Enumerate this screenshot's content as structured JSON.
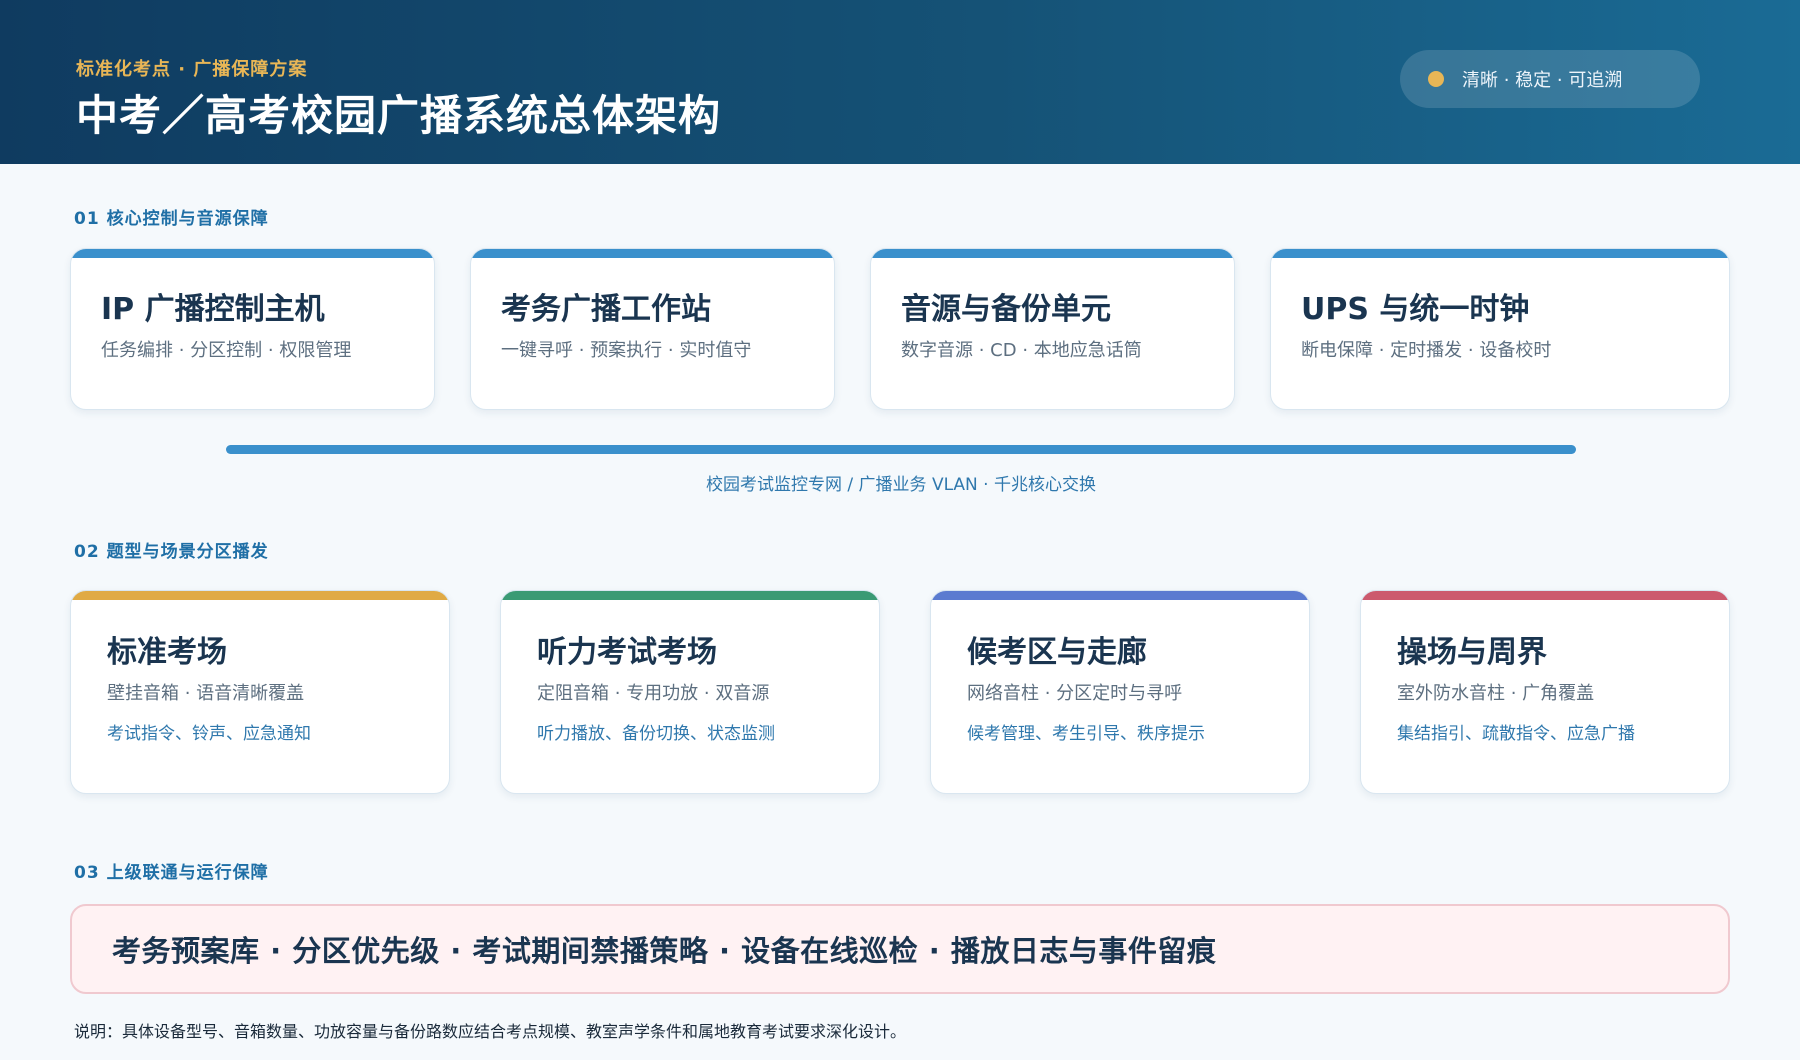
{
  "header": {
    "eyebrow": "标准化考点 · 广播保障方案",
    "title": "中考／高考校园广播系统总体架构",
    "badge": "清晰 · 稳定 · 可追溯",
    "badge_dot_color": "#e8b656"
  },
  "sections": [
    {
      "heading": "01 核心控制与音源保障"
    },
    {
      "heading": "02 题型与场景分区播发"
    },
    {
      "heading": "03 上级联通与运行保障"
    }
  ],
  "core_cards": [
    {
      "title": "IP 广播控制主机",
      "subtitle": "任务编排 · 分区控制 · 权限管理",
      "accent": "#3a90cc"
    },
    {
      "title": "考务广播工作站",
      "subtitle": "一键寻呼 · 预案执行 · 实时值守",
      "accent": "#3a90cc"
    },
    {
      "title": "音源与备份单元",
      "subtitle": "数字音源 · CD · 本地应急话筒",
      "accent": "#3a90cc"
    },
    {
      "title": "UPS 与统一时钟",
      "subtitle": "断电保障 · 定时播发 · 设备校时",
      "accent": "#3a90cc"
    }
  ],
  "network": {
    "label": "校园考试监控专网 / 广播业务 VLAN · 千兆核心交换",
    "color": "#3a90cc"
  },
  "zone_cards": [
    {
      "title": "标准考场",
      "subtitle": "壁挂音箱 · 语音清晰覆盖",
      "description": "考试指令、铃声、应急通知",
      "accent": "#e0aa45"
    },
    {
      "title": "听力考试考场",
      "subtitle": "定阻音箱 · 专用功放 · 双音源",
      "description": "听力播放、备份切换、状态监测",
      "accent": "#3a9a74"
    },
    {
      "title": "候考区与走廊",
      "subtitle": "网络音柱 · 分区定时与寻呼",
      "description": "候考管理、考生引导、秩序提示",
      "accent": "#5b7bd0"
    },
    {
      "title": "操场与周界",
      "subtitle": "室外防水音柱 · 广角覆盖",
      "description": "集结指引、疏散指令、应急广播",
      "accent": "#cc5a6e"
    }
  ],
  "banner": {
    "text": "考务预案库 · 分区优先级 · 考试期间禁播策略 · 设备在线巡检 · 播放日志与事件留痕"
  },
  "footnote": "说明：具体设备型号、音箱数量、功放容量与备份路数应结合考点规模、教室声学条件和属地教育考试要求深化设计。"
}
